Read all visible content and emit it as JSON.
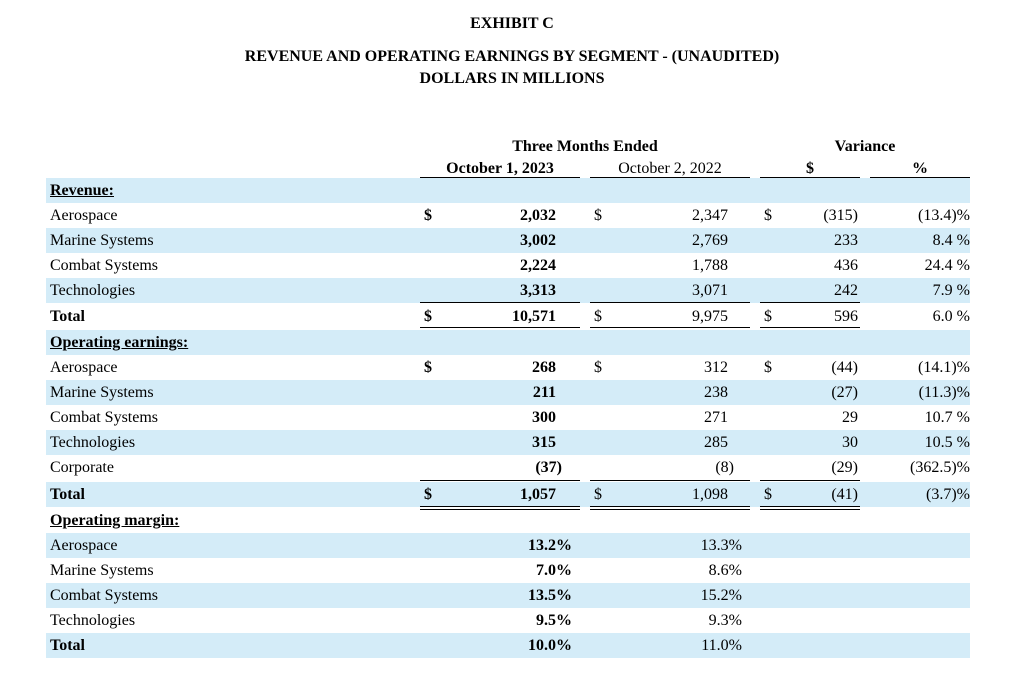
{
  "exhibit": "EXHIBIT C",
  "title": "REVENUE AND OPERATING EARNINGS BY SEGMENT - (UNAUDITED)",
  "subtitle": "DOLLARS IN MILLIONS",
  "headers": {
    "three_months": "Three Months Ended",
    "variance": "Variance",
    "col_2023": "October 1, 2023",
    "col_2022": "October 2, 2022",
    "col_var_dollar": "$",
    "col_var_pct": "%"
  },
  "currency": "$",
  "sections": {
    "revenue": {
      "label": "Revenue:",
      "rows": [
        {
          "label": "Aerospace",
          "v2023": "2,032",
          "v2022": "2,347",
          "var": "(315)",
          "pct": "(13.4)%"
        },
        {
          "label": "Marine Systems",
          "v2023": "3,002",
          "v2022": "2,769",
          "var": "233",
          "pct": "8.4 %"
        },
        {
          "label": "Combat Systems",
          "v2023": "2,224",
          "v2022": "1,788",
          "var": "436",
          "pct": "24.4 %"
        },
        {
          "label": "Technologies",
          "v2023": "3,313",
          "v2022": "3,071",
          "var": "242",
          "pct": "7.9 %"
        }
      ],
      "total": {
        "label": "Total",
        "v2023": "10,571",
        "v2022": "9,975",
        "var": "596",
        "pct": "6.0 %"
      }
    },
    "operating_earnings": {
      "label": "Operating earnings:",
      "rows": [
        {
          "label": "Aerospace",
          "v2023": "268",
          "v2022": "312",
          "var": "(44)",
          "pct": "(14.1)%"
        },
        {
          "label": "Marine Systems",
          "v2023": "211",
          "v2022": "238",
          "var": "(27)",
          "pct": "(11.3)%"
        },
        {
          "label": "Combat Systems",
          "v2023": "300",
          "v2022": "271",
          "var": "29",
          "pct": "10.7 %"
        },
        {
          "label": "Technologies",
          "v2023": "315",
          "v2022": "285",
          "var": "30",
          "pct": "10.5 %"
        },
        {
          "label": "Corporate",
          "v2023": "(37)",
          "v2022": "(8)",
          "var": "(29)",
          "pct": "(362.5)%"
        }
      ],
      "total": {
        "label": "Total",
        "v2023": "1,057",
        "v2022": "1,098",
        "var": "(41)",
        "pct": "(3.7)%"
      }
    },
    "operating_margin": {
      "label": "Operating margin:",
      "rows": [
        {
          "label": "Aerospace",
          "v2023": "13.2%",
          "v2022": "13.3%"
        },
        {
          "label": "Marine Systems",
          "v2023": "7.0%",
          "v2022": "8.6%"
        },
        {
          "label": "Combat Systems",
          "v2023": "13.5%",
          "v2022": "15.2%"
        },
        {
          "label": "Technologies",
          "v2023": "9.5%",
          "v2022": "9.3%"
        }
      ],
      "total": {
        "label": "Total",
        "v2023": "10.0%",
        "v2022": "11.0%"
      }
    }
  }
}
